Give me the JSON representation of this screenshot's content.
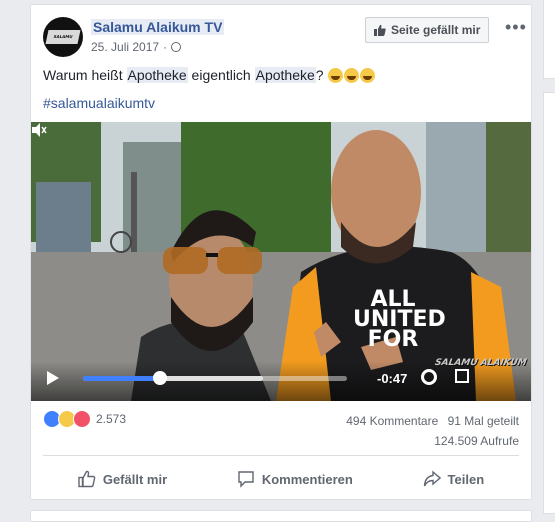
{
  "post": {
    "page_name": "Salamu Alaikum TV",
    "date": "25. Juli 2017",
    "like_page_button": "Seite gefällt mir",
    "more_menu": "•••",
    "text_before": "Warum heißt ",
    "text_word1": "Apotheke",
    "text_middle": " eigentlich ",
    "text_word2": "Apotheke",
    "text_after": "?",
    "hashtag": "#salamualaikumtv",
    "avatar_logo_text": "SALAMU ALAIKUM"
  },
  "video": {
    "time_remaining": "-0:47",
    "progress_fraction": 0.29,
    "buffered_fraction": 0.68,
    "watermark": "SALAMU ALAIKUM",
    "shirt_text": "ALL UNITED FOR"
  },
  "engagement": {
    "reaction_count": "2.573",
    "comments": "494 Kommentare",
    "shares": "91 Mal geteilt",
    "views": "124.509 Aufrufe"
  },
  "actions": {
    "like": "Gefällt mir",
    "comment": "Kommentieren",
    "share": "Teilen"
  },
  "colors": {
    "link": "#365899",
    "progress": "#4080ff",
    "like_reaction": "#4080ff",
    "love_reaction": "#f25268",
    "haha_reaction": "#f7c948"
  }
}
